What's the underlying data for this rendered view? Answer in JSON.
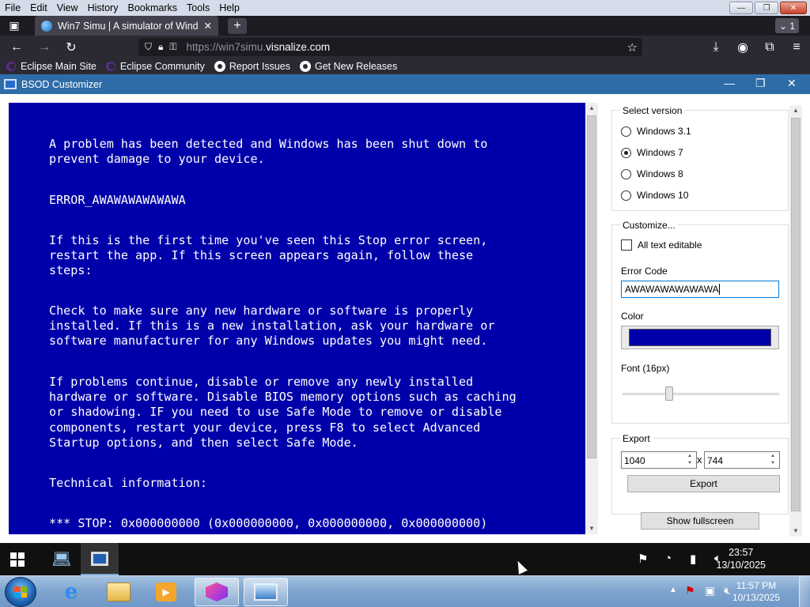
{
  "browser": {
    "menu": [
      "File",
      "Edit",
      "View",
      "History",
      "Bookmarks",
      "Tools",
      "Help"
    ],
    "tab_title": "Win7 Simu | A simulator of Wind",
    "tab_count": "1",
    "url_prefix": "https://win7simu.",
    "url_host": "visnalize.com",
    "bookmarks": [
      "Eclipse Main Site",
      "Eclipse Community",
      "Report Issues",
      "Get New Releases"
    ]
  },
  "app": {
    "title": "BSOD Customizer",
    "bsod": {
      "p1": "A problem has been detected and Windows has been shut down to\nprevent damage to your device.",
      "p2": "ERROR_AWAWAWAWAWAWA",
      "p3": "If this is the first time you've seen this Stop error screen,\nrestart the app. If this screen appears again, follow these\nsteps:",
      "p4": "Check to make sure any new hardware or software is properly\ninstalled. If this is a new installation, ask your hardware or\nsoftware manufacturer for any Windows updates you might need.",
      "p5": "If problems continue, disable or remove any newly installed\nhardware or software. Disable BIOS memory options such as caching\nor shadowing. IF you need to use Safe Mode to remove or disable\ncomponents, restart your device, press F8 to select Advanced\nStartup options, and then select Safe Mode.",
      "p6": "Technical information:",
      "p7": "*** STOP: 0x000000000 (0x000000000, 0x000000000, 0x000000000)"
    },
    "version_group": "Select version",
    "versions": [
      "Windows 3.1",
      "Windows 7",
      "Windows 8",
      "Windows 10"
    ],
    "selected_version": "Windows 7",
    "customize_group": "Customize...",
    "all_text_editable": "All text editable",
    "error_code_label": "Error Code",
    "error_code_value": "AWAWAWAWAWAWA",
    "color_label": "Color",
    "bsod_color": "#0000aa",
    "font_label": "Font (16px)",
    "font_slider_fraction": 0.3,
    "export_group": "Export",
    "export_width": "1040",
    "export_x": "x",
    "export_height": "744",
    "export_button": "Export",
    "fullscreen_button": "Show fullscreen"
  },
  "guest_taskbar": {
    "time": "23:57",
    "date": "13/10/2025"
  },
  "host_taskbar": {
    "time": "11:57 PM",
    "date": "10/13/2025"
  }
}
